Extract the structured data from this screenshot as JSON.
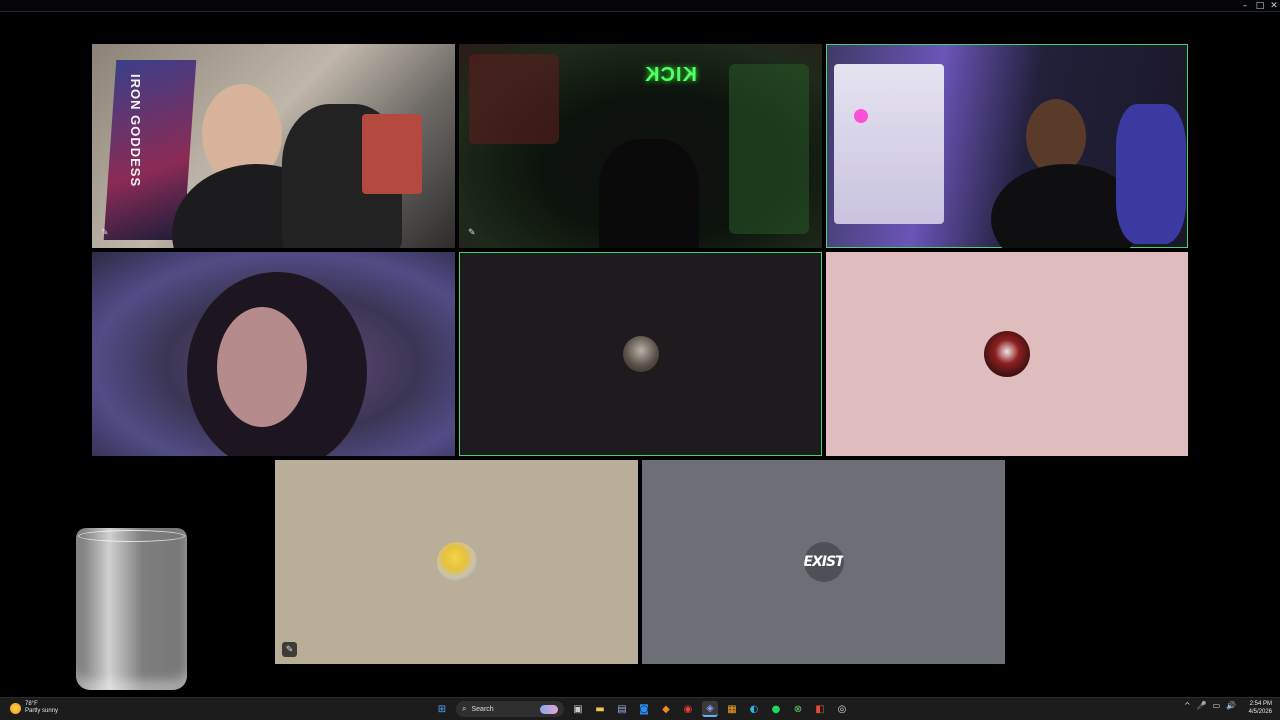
{
  "window": {
    "controls": {
      "minimize": "–",
      "maximize": "□",
      "close": "✕"
    }
  },
  "tiles": [
    {
      "id": "tile-1",
      "type": "video",
      "active": false,
      "banner_text": "IRON GODDESS"
    },
    {
      "id": "tile-2",
      "type": "video",
      "active": false,
      "sign_text": "KICK"
    },
    {
      "id": "tile-3",
      "type": "video",
      "active": true
    },
    {
      "id": "tile-4",
      "type": "video",
      "active": false
    },
    {
      "id": "tile-5",
      "type": "avatar",
      "active": true,
      "background": "#1e1b1f"
    },
    {
      "id": "tile-6",
      "type": "avatar",
      "active": false,
      "background": "#dfbcbe"
    },
    {
      "id": "tile-7",
      "type": "avatar",
      "active": false,
      "background": "#b9ae97",
      "muted": true
    },
    {
      "id": "tile-8",
      "type": "avatar",
      "active": false,
      "background": "#6c6f75",
      "avatar_text": "EXIST"
    }
  ],
  "taskbar": {
    "weather": {
      "temp": "78°F",
      "condition": "Partly sunny"
    },
    "search_placeholder": "Search",
    "apps": [
      "windows-start",
      "search",
      "task-view",
      "file-explorer",
      "store",
      "outlook",
      "chrome-like",
      "discord",
      "streamlabs",
      "orange-app",
      "edge",
      "spotify",
      "xbox",
      "office",
      "obs"
    ],
    "tray": {
      "chevron": "^",
      "mic": "🎤",
      "display": "▭",
      "volume": "🔊"
    },
    "clock": {
      "time": "2:54 PM",
      "date": "4/5/2026"
    }
  },
  "colors": {
    "active_outline": "#4ad26c",
    "taskbar": "#1c1c1c"
  }
}
